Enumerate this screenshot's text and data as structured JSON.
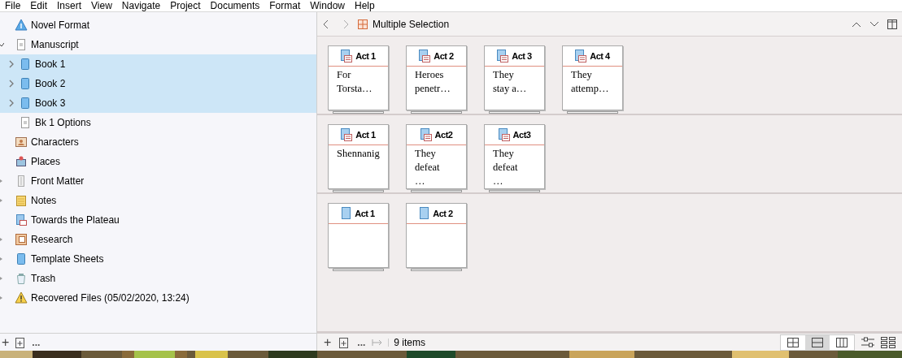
{
  "menu_bar": [
    "File",
    "Edit",
    "Insert",
    "View",
    "Navigate",
    "Project",
    "Documents",
    "Format",
    "Window",
    "Help"
  ],
  "binder": {
    "items": [
      {
        "label": "Novel Format",
        "kind": "info",
        "selected": false
      },
      {
        "label": "Manuscript",
        "kind": "text",
        "selected": false,
        "expanded": true,
        "children": [
          {
            "label": "Book 1",
            "kind": "book",
            "selected": true,
            "expanded": false
          },
          {
            "label": "Book 2",
            "kind": "book",
            "selected": true,
            "expanded": false
          },
          {
            "label": "Book 3",
            "kind": "book",
            "selected": true,
            "expanded": false
          },
          {
            "label": "Bk 1 Options",
            "kind": "text",
            "selected": false
          }
        ]
      },
      {
        "label": "Characters",
        "kind": "characters",
        "selected": false
      },
      {
        "label": "Places",
        "kind": "places",
        "selected": false
      },
      {
        "label": "Front Matter",
        "kind": "folder",
        "selected": false,
        "expanded": false
      },
      {
        "label": "Notes",
        "kind": "notes",
        "selected": false,
        "expanded": false
      },
      {
        "label": "Towards the Plateau",
        "kind": "sheet",
        "selected": false
      },
      {
        "label": "Research",
        "kind": "research",
        "selected": false,
        "expanded": false
      },
      {
        "label": "Template Sheets",
        "kind": "book",
        "selected": false,
        "expanded": false
      },
      {
        "label": "Trash",
        "kind": "trash",
        "selected": false,
        "expanded": false
      },
      {
        "label": "Recovered Files (05/02/2020, 13:24)",
        "kind": "warning",
        "selected": false,
        "expanded": false
      }
    ],
    "toolbar": [
      "+",
      "..."
    ]
  },
  "editor": {
    "title": "Multiple Selection",
    "groups": [
      [
        {
          "title": "Act 1",
          "kind": "stack",
          "synopsis": "For Torsta…"
        },
        {
          "title": "Act 2",
          "kind": "stack",
          "synopsis": "Heroes penetr…"
        },
        {
          "title": "Act 3",
          "kind": "stack",
          "synopsis": "They stay a…"
        },
        {
          "title": "Act 4",
          "kind": "stack",
          "synopsis": "They attemp…"
        }
      ],
      [
        {
          "title": "Act 1",
          "kind": "stack",
          "synopsis": "Shennanig"
        },
        {
          "title": "Act2",
          "kind": "stack",
          "synopsis": "They defeat …"
        },
        {
          "title": "Act3",
          "kind": "stack",
          "synopsis": "They defeat …"
        }
      ],
      [
        {
          "title": "Act 1",
          "kind": "doc"
        },
        {
          "title": "Act 2",
          "kind": "doc"
        }
      ]
    ],
    "footer": {
      "add": "+",
      "more": "...",
      "count": "9 items",
      "views": [
        {
          "kind": "grid",
          "selected": false
        },
        {
          "kind": "rows",
          "selected": true
        },
        {
          "kind": "columns",
          "selected": false
        }
      ]
    }
  }
}
